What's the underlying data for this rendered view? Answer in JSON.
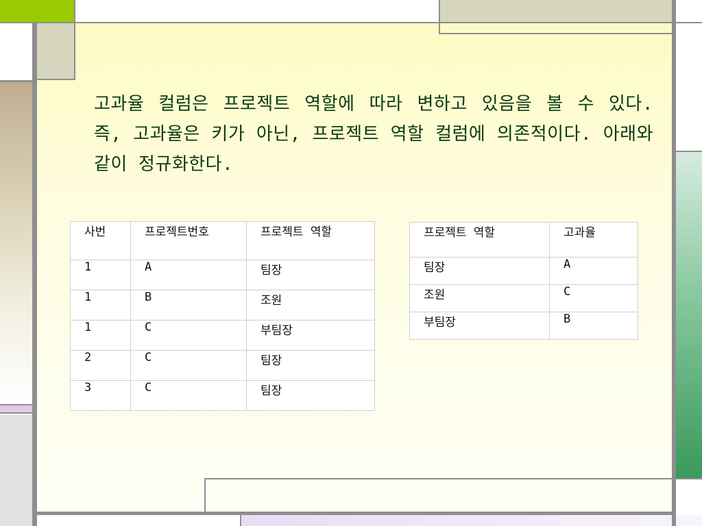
{
  "paragraph": "고과율 컬럼은 프로젝트 역할에 따라 변하고 있음을 볼 수 있다. 즉, 고과율은 키가 아닌, 프로젝트 역할 컬럼에 의존적이다. 아래와 같이 정규화한다.",
  "table1": {
    "headers": [
      "사번",
      "프로젝트번호",
      "프로젝트 역할"
    ],
    "rows": [
      [
        "1",
        "A",
        "팀장"
      ],
      [
        "1",
        "B",
        "조원"
      ],
      [
        "1",
        "C",
        "부팀장"
      ],
      [
        "2",
        "C",
        "팀장"
      ],
      [
        "3",
        "C",
        "팀장"
      ]
    ]
  },
  "table2": {
    "headers": [
      "프로젝트 역할",
      "고과율"
    ],
    "rows": [
      [
        "팀장",
        "A"
      ],
      [
        "조원",
        "C"
      ],
      [
        "부팀장",
        "B"
      ]
    ]
  },
  "colors": {
    "accent_green": "#99cc00",
    "text": "#0a3a14",
    "frame": "#8e8e8e"
  }
}
